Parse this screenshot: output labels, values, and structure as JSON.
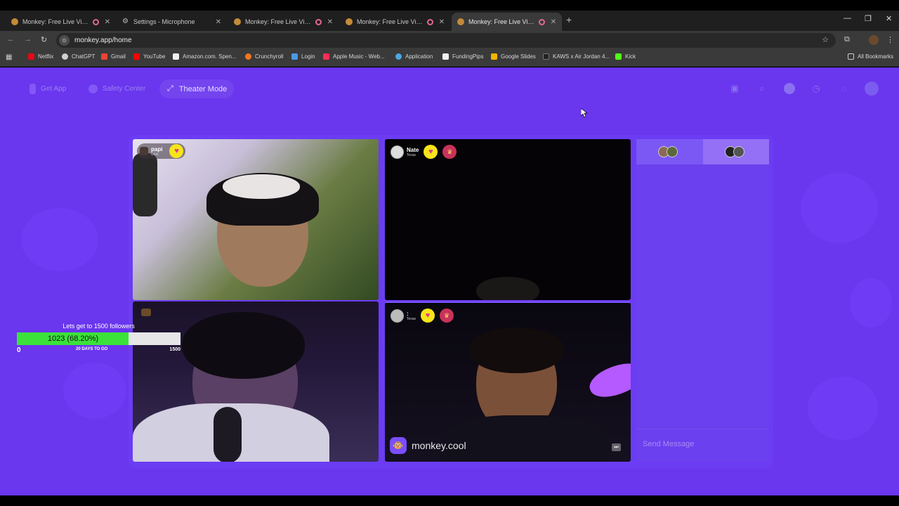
{
  "browser": {
    "tabs": [
      {
        "title": "Monkey: Free Live Video Ch",
        "active": false,
        "recording": true
      },
      {
        "title": "Settings - Microphone",
        "active": false,
        "recording": false
      },
      {
        "title": "Monkey: Free Live Video Ch",
        "active": false,
        "recording": true
      },
      {
        "title": "Monkey: Free Live Video Ch",
        "active": false,
        "recording": true
      },
      {
        "title": "Monkey: Free Live Video Ch",
        "active": true,
        "recording": true
      }
    ],
    "url": "monkey.app/home",
    "bookmarks": [
      {
        "label": "Netflix",
        "color": "#e50914"
      },
      {
        "label": "ChatGPT",
        "color": "#cfcfcf"
      },
      {
        "label": "Gmail",
        "color": "#ea4335"
      },
      {
        "label": "YouTube",
        "color": "#ff0000"
      },
      {
        "label": "Amazon.com. Spen...",
        "color": "#f0f0f0"
      },
      {
        "label": "Crunchyroll",
        "color": "#f47521"
      },
      {
        "label": "Login",
        "color": "#4a9ae0"
      },
      {
        "label": "Apple Music - Web...",
        "color": "#fa2d55"
      },
      {
        "label": "Application",
        "color": "#4aa8e0"
      },
      {
        "label": "FundingPips",
        "color": "#f0f0f0"
      },
      {
        "label": "Google Slides",
        "color": "#f4b400"
      },
      {
        "label": "KAWS x Air Jordan 4...",
        "color": "#222222"
      },
      {
        "label": "Kick",
        "color": "#53fc18"
      }
    ],
    "all_bookmarks": "All Bookmarks"
  },
  "app": {
    "nav": {
      "get_app": "Get App",
      "safety_center": "Safety Center",
      "theater_mode": "Theater Mode"
    },
    "tiles": [
      {
        "name": "papi",
        "location": "Utah"
      },
      {
        "name": "Nate",
        "location": "Texas"
      },
      {
        "name": "",
        "location": ""
      },
      {
        "name": ":",
        "location": "Texas"
      }
    ],
    "watermark": "monkey.cool",
    "chat": {
      "placeholder": "Send Message"
    }
  },
  "follower_goal": {
    "title": "Lets get to 1500 followers",
    "current": 1023,
    "progress_label": "1023 (68.20%)",
    "percent": 68.2,
    "min": "0",
    "max": "1500",
    "days_left": "20 DAYS TO GO"
  },
  "colors": {
    "page_bg": "#6a36ee",
    "progress_fill": "#3be23a",
    "heart_badge": "#f6e51a"
  }
}
